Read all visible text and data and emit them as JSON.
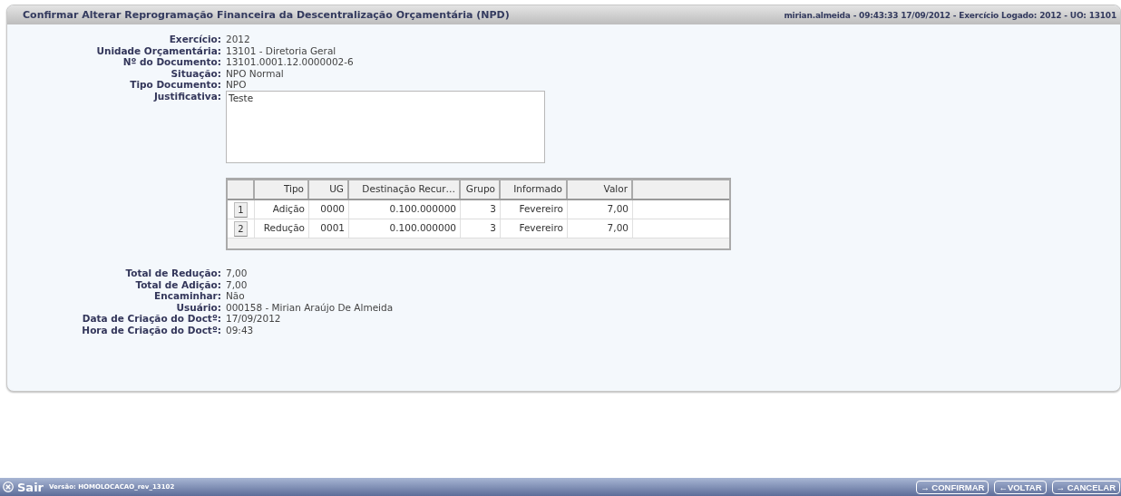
{
  "header": {
    "title": "Confirmar Alterar Reprogramação Financeira da Descentralização Orçamentária (NPD)",
    "session": "mirian.almeida - 09:43:33 17/09/2012 - Exercício Logado: 2012 - UO: 13101"
  },
  "fields_top": [
    {
      "label": "Exercício:",
      "value": "2012"
    },
    {
      "label": "Unidade Orçamentária:",
      "value": "13101 - Diretoria Geral"
    },
    {
      "label": "Nº do Documento:",
      "value": "13101.0001.12.0000002-6"
    },
    {
      "label": "Situação:",
      "value": "NPO Normal"
    },
    {
      "label": "Tipo Documento:",
      "value": "NPO"
    },
    {
      "label": "Justificativa:",
      "value": "Teste",
      "kind": "textarea"
    }
  ],
  "table": {
    "columns": [
      "Tipo",
      "UG",
      "Destinação Recur…",
      "Grupo",
      "Informado",
      "Valor"
    ],
    "rows": [
      {
        "number": "1",
        "cells": [
          "Adição",
          "0000",
          "0.100.000000",
          "3",
          "Fevereiro",
          "7,00"
        ]
      },
      {
        "number": "2",
        "cells": [
          "Redução",
          "0001",
          "0.100.000000",
          "3",
          "Fevereiro",
          "7,00"
        ]
      }
    ]
  },
  "fields_bottom": [
    {
      "label": "Total de Redução:",
      "value": "7,00"
    },
    {
      "label": "Total de Adição:",
      "value": "7,00"
    },
    {
      "label": "Encaminhar:",
      "value": "Não"
    },
    {
      "label": "Usuário:",
      "value": "000158 - Mirian Araújo De Almeida"
    },
    {
      "label": "Data de Criação do Doctº:",
      "value": "17/09/2012"
    },
    {
      "label": "Hora de Criação do Doctº:",
      "value": "09:43"
    }
  ],
  "footer": {
    "exit": "Sair",
    "version": "Versão: HOMOLOCACAO_rev_13102",
    "buttons": [
      "→ CONFIRMAR",
      "←VOLTAR",
      "→ CANCELAR"
    ]
  }
}
